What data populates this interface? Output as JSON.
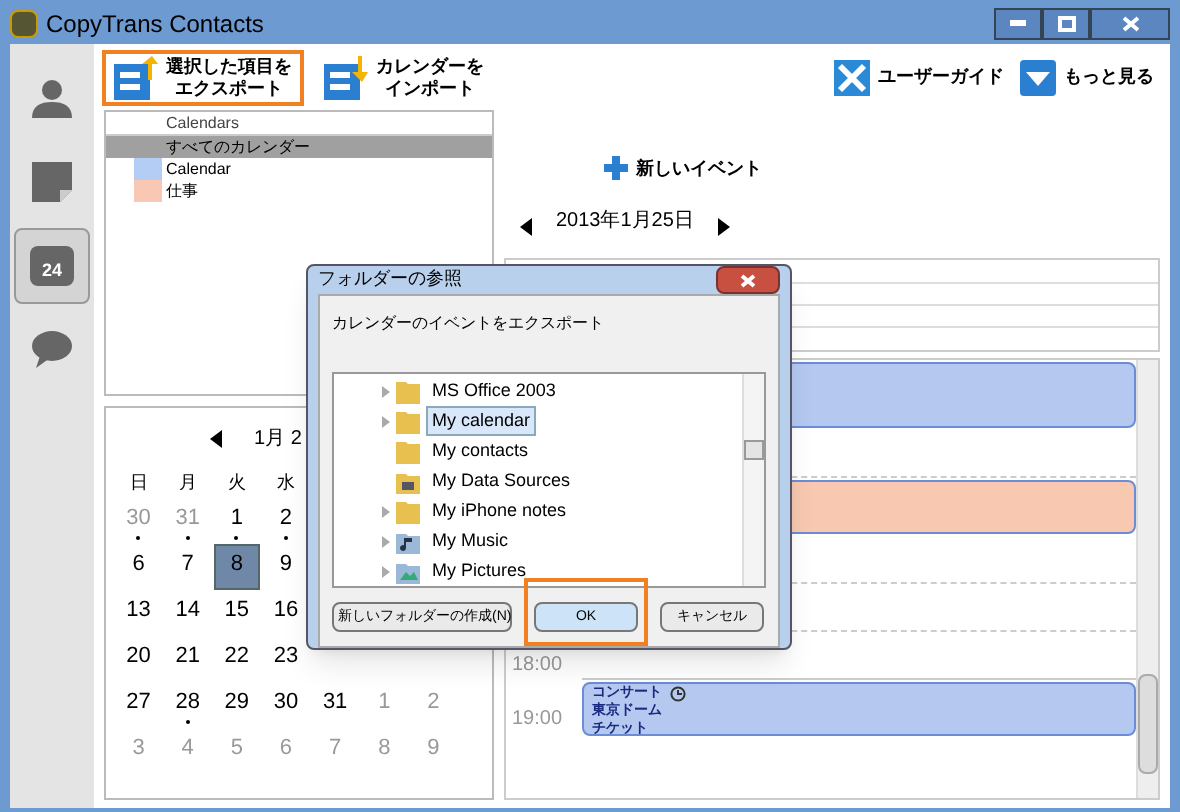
{
  "window": {
    "title": "CopyTrans Contacts"
  },
  "sidebar": {
    "items": [
      {
        "kind": "contacts",
        "selected": false
      },
      {
        "kind": "notes",
        "selected": false
      },
      {
        "kind": "calendar",
        "badge": "24",
        "selected": true
      },
      {
        "kind": "messages",
        "selected": false
      }
    ]
  },
  "toolbar": {
    "left": [
      {
        "kind": "export",
        "lines": [
          "選択した項目を",
          "エクスポート"
        ],
        "highlighted": true
      },
      {
        "kind": "import",
        "lines": [
          "カレンダーを",
          "インポート"
        ],
        "highlighted": false
      }
    ],
    "right": [
      {
        "kind": "guide",
        "label": "ユーザーガイド"
      },
      {
        "kind": "more",
        "label": "もっと見る"
      }
    ]
  },
  "calendars": {
    "header": "Calendars",
    "rows": [
      {
        "name": "すべてのカレンダー",
        "selected": true
      },
      {
        "name": "Calendar",
        "color": "#b4cdf5",
        "selected": false
      },
      {
        "name": "仕事",
        "color": "#f8c8b4",
        "selected": false
      }
    ]
  },
  "mini_calendar": {
    "month": "1月 2",
    "weekdays": [
      "日",
      "月",
      "火",
      "水"
    ],
    "rows": [
      [
        {
          "day": "30",
          "other_month": true,
          "has_events": true,
          "selected": false
        },
        {
          "day": "31",
          "other_month": true,
          "has_events": true,
          "selected": false
        },
        {
          "day": "1",
          "other_month": false,
          "has_events": true,
          "selected": false
        },
        {
          "day": "2",
          "other_month": false,
          "has_events": true,
          "selected": false
        }
      ],
      [
        {
          "day": "6",
          "other_month": false,
          "has_events": false,
          "selected": false
        },
        {
          "day": "7",
          "other_month": false,
          "has_events": false,
          "selected": false
        },
        {
          "day": "8",
          "other_month": false,
          "has_events": false,
          "selected": true
        },
        {
          "day": "9",
          "other_month": false,
          "has_events": false,
          "selected": false
        }
      ],
      [
        {
          "day": "13",
          "other_month": false,
          "has_events": false,
          "selected": false
        },
        {
          "day": "14",
          "other_month": false,
          "has_events": false,
          "selected": false
        },
        {
          "day": "15",
          "other_month": false,
          "has_events": false,
          "selected": false
        },
        {
          "day": "16",
          "other_month": false,
          "has_events": false,
          "selected": false
        }
      ],
      [
        {
          "day": "20",
          "other_month": false,
          "has_events": false,
          "selected": false
        },
        {
          "day": "21",
          "other_month": false,
          "has_events": false,
          "selected": false
        },
        {
          "day": "22",
          "other_month": false,
          "has_events": false,
          "selected": false
        },
        {
          "day": "23",
          "other_month": false,
          "has_events": false,
          "selected": false
        }
      ],
      [
        {
          "day": "27",
          "other_month": false,
          "has_events": false,
          "selected": false
        },
        {
          "day": "28",
          "other_month": false,
          "has_events": true,
          "selected": false
        },
        {
          "day": "29",
          "other_month": false,
          "has_events": false,
          "selected": false
        },
        {
          "day": "30",
          "other_month": false,
          "has_events": false,
          "selected": false
        },
        {
          "day": "31",
          "other_month": false,
          "has_events": false,
          "selected": false
        },
        {
          "day": "1",
          "other_month": true,
          "has_events": false,
          "selected": false
        },
        {
          "day": "2",
          "other_month": true,
          "has_events": false,
          "selected": false
        }
      ],
      [
        {
          "day": "3",
          "other_month": true,
          "has_events": false,
          "selected": false
        },
        {
          "day": "4",
          "other_month": true,
          "has_events": false,
          "selected": false
        },
        {
          "day": "5",
          "other_month": true,
          "has_events": false,
          "selected": false
        },
        {
          "day": "6",
          "other_month": true,
          "has_events": false,
          "selected": false
        },
        {
          "day": "7",
          "other_month": true,
          "has_events": false,
          "selected": false
        },
        {
          "day": "8",
          "other_month": true,
          "has_events": false,
          "selected": false
        },
        {
          "day": "9",
          "other_month": true,
          "has_events": false,
          "selected": false
        }
      ]
    ]
  },
  "day_view": {
    "new_event": "新しいイベント",
    "date": "2013年1月25日",
    "rows": [
      {
        "kind": "event",
        "color": "#b4c8f0",
        "lines": []
      },
      {
        "kind": "blank"
      },
      {
        "kind": "event",
        "color": "#f8c8b0",
        "lines": []
      },
      {
        "kind": "blank"
      },
      {
        "kind": "blank"
      },
      {
        "kind": "hour",
        "time": "18:00"
      },
      {
        "kind": "event",
        "time": "19:00",
        "color": "#b4c8f0",
        "lines": [
          "コンサート",
          "東京ドーム",
          "チケット"
        ]
      }
    ]
  },
  "dialog": {
    "title": "フォルダーの参照",
    "message": "カレンダーのイベントをエクスポート",
    "folders": [
      {
        "name": "MS Office 2003",
        "kind": "folder",
        "expandable": true,
        "selected": false
      },
      {
        "name": "My calendar",
        "kind": "folder",
        "expandable": true,
        "selected": true
      },
      {
        "name": "My contacts",
        "kind": "folder",
        "expandable": false,
        "selected": false
      },
      {
        "name": "My Data Sources",
        "kind": "data",
        "expandable": false,
        "selected": false
      },
      {
        "name": "My iPhone notes",
        "kind": "folder",
        "expandable": true,
        "selected": false
      },
      {
        "name": "My Music",
        "kind": "music",
        "expandable": true,
        "selected": false
      },
      {
        "name": "My Pictures",
        "kind": "pictures",
        "expandable": true,
        "selected": false
      }
    ],
    "buttons": [
      {
        "label": "新しいフォルダーの作成(N)",
        "highlighted": false
      },
      {
        "label": "OK",
        "highlighted": true
      },
      {
        "label": "キャンセル",
        "highlighted": false
      }
    ]
  }
}
